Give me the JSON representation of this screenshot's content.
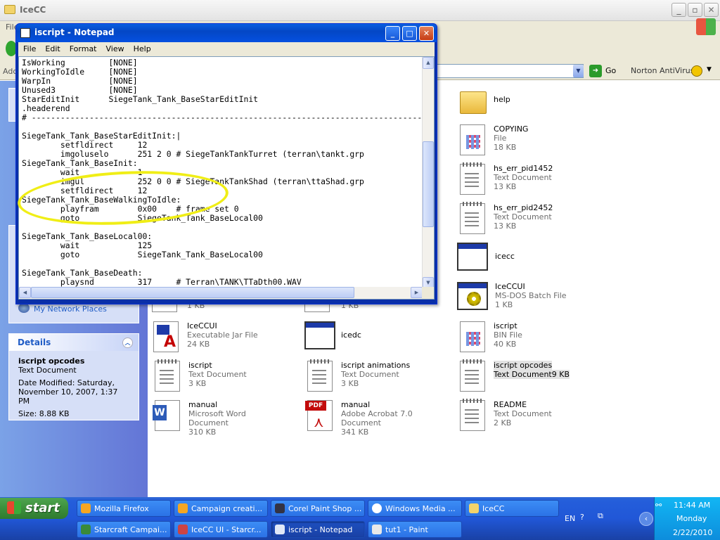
{
  "explorer": {
    "title": "IceCC",
    "menu_stub": "File",
    "address_stub": "Add",
    "go_label": "Go",
    "norton": "Norton AntiVirus"
  },
  "notepad": {
    "title": "iscript - Notepad",
    "menu": [
      "File",
      "Edit",
      "Format",
      "View",
      "Help"
    ],
    "text": "IsWorking         [NONE]\nWorkingToIdle     [NONE]\nWarpIn            [NONE]\nUnused3           [NONE]\nStarEditInit      SiegeTank_Tank_BaseStarEditInit\n.headerend\n# ----------------------------------------------------------------------------------\n\nSiegeTank_Tank_BaseStarEditInit:|\n        setfldirect     12\n        imgoluselo      251 2 0 # SiegeTankTankTurret (terran\\tankt.grp\nSiegeTank_Tank_BaseInit:\n        wait            1\n        imgul           252 0 0 # SiegeTankTankShad (terran\\ttaShad.grp\n        setfldirect     12\nSiegeTank_Tank_BaseWalkingToIdle:\n        playfram        0x00    # frame set 0\n        goto            SiegeTank_Tank_BaseLocal00\n\nSiegeTank_Tank_BaseLocal00:\n        wait            125\n        goto            SiegeTank_Tank_BaseLocal00\n\nSiegeTank_Tank_BaseDeath:\n        playsnd         317     # Terran\\TANK\\TTaDth00.WAV"
  },
  "sidebar": {
    "network_places": "My Network Places",
    "details": {
      "header": "Details",
      "name": "iscript opcodes",
      "type": "Text Document",
      "modified": "Date Modified: Saturday, November 10, 2007, 1:37 PM",
      "size": "Size: 8.88 KB"
    }
  },
  "files": {
    "help": {
      "name": "help"
    },
    "copying": {
      "name": "COPYING",
      "type": "File",
      "size": "18 KB"
    },
    "hs1": {
      "name": "hs_err_pid1452",
      "type": "Text Document",
      "size": "13 KB"
    },
    "hs2": {
      "name": "hs_err_pid2452",
      "type": "Text Document",
      "size": "13 KB"
    },
    "icecc": {
      "name": "icecc"
    },
    "icecc_bat": {
      "name": "IceCCUI",
      "type": "MS-DOS Batch File",
      "size": "1 KB"
    },
    "partial1": {
      "size": "1 KB"
    },
    "partial2": {
      "size": "1 KB"
    },
    "iceccui_jar": {
      "name": "IceCCUI",
      "type": "Executable Jar File",
      "size": "24 KB"
    },
    "icedc": {
      "name": "icedc"
    },
    "iscript_bin": {
      "name": "iscript",
      "type": "BIN File",
      "size": "40 KB"
    },
    "iscript_txt": {
      "name": "iscript",
      "type": "Text Document",
      "size": "3 KB"
    },
    "iscript_anim": {
      "name": "iscript animations",
      "type": "Text Document",
      "size": "3 KB"
    },
    "iscript_opc": {
      "name": "iscript opcodes",
      "type": "Text Document",
      "size": "9 KB"
    },
    "manual_doc": {
      "name": "manual",
      "type": "Microsoft Word Document",
      "size": "310 KB"
    },
    "manual_pdf": {
      "name": "manual",
      "type": "Adobe Acrobat 7.0 Document",
      "size": "341 KB"
    },
    "readme": {
      "name": "README",
      "type": "Text Document",
      "size": "2 KB"
    }
  },
  "taskbar": {
    "start": "start",
    "row1": [
      "Mozilla Firefox",
      "Campaign creati...",
      "Corel Paint Shop ...",
      "Windows Media ...",
      "IceCC"
    ],
    "row2": [
      "Starcraft Campai...",
      "IceCC UI - Starcr...",
      "iscript - Notepad",
      "tut1 - Paint"
    ],
    "lang": "EN",
    "time": "11:44 AM",
    "day": "Monday",
    "date": "2/22/2010"
  },
  "colors": {
    "highlight_circle": "#f0ee16",
    "titlebar": "#0a5ee0",
    "sidebar": "#7ba2e7"
  }
}
